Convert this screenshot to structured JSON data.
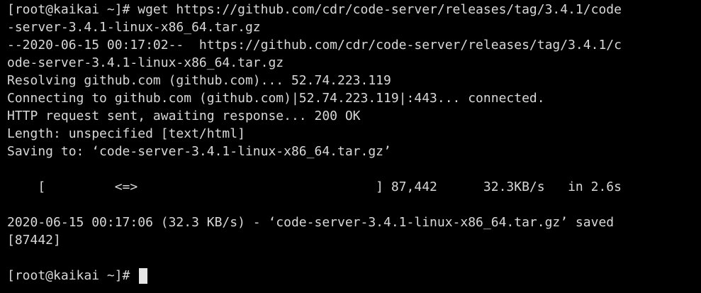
{
  "terminal": {
    "lines": [
      "[root@kaikai ~]# wget https://github.com/cdr/code-server/releases/tag/3.4.1/code",
      "-server-3.4.1-linux-x86_64.tar.gz",
      "--2020-06-15 00:17:02--  https://github.com/cdr/code-server/releases/tag/3.4.1/c",
      "ode-server-3.4.1-linux-x86_64.tar.gz",
      "Resolving github.com (github.com)... 52.74.223.119",
      "Connecting to github.com (github.com)|52.74.223.119|:443... connected.",
      "HTTP request sent, awaiting response... 200 OK",
      "Length: unspecified [text/html]",
      "Saving to: ‘code-server-3.4.1-linux-x86_64.tar.gz’",
      "",
      "    [         <=>                               ] 87,442      32.3KB/s   in 2.6s",
      "",
      "2020-06-15 00:17:06 (32.3 KB/s) - ‘code-server-3.4.1-linux-x86_64.tar.gz’ saved",
      "[87442]",
      ""
    ],
    "prompt": "[root@kaikai ~]#",
    "colors": {
      "background": "#000000",
      "foreground": "#d8d8d8",
      "cursor": "#e6e6e6"
    }
  }
}
